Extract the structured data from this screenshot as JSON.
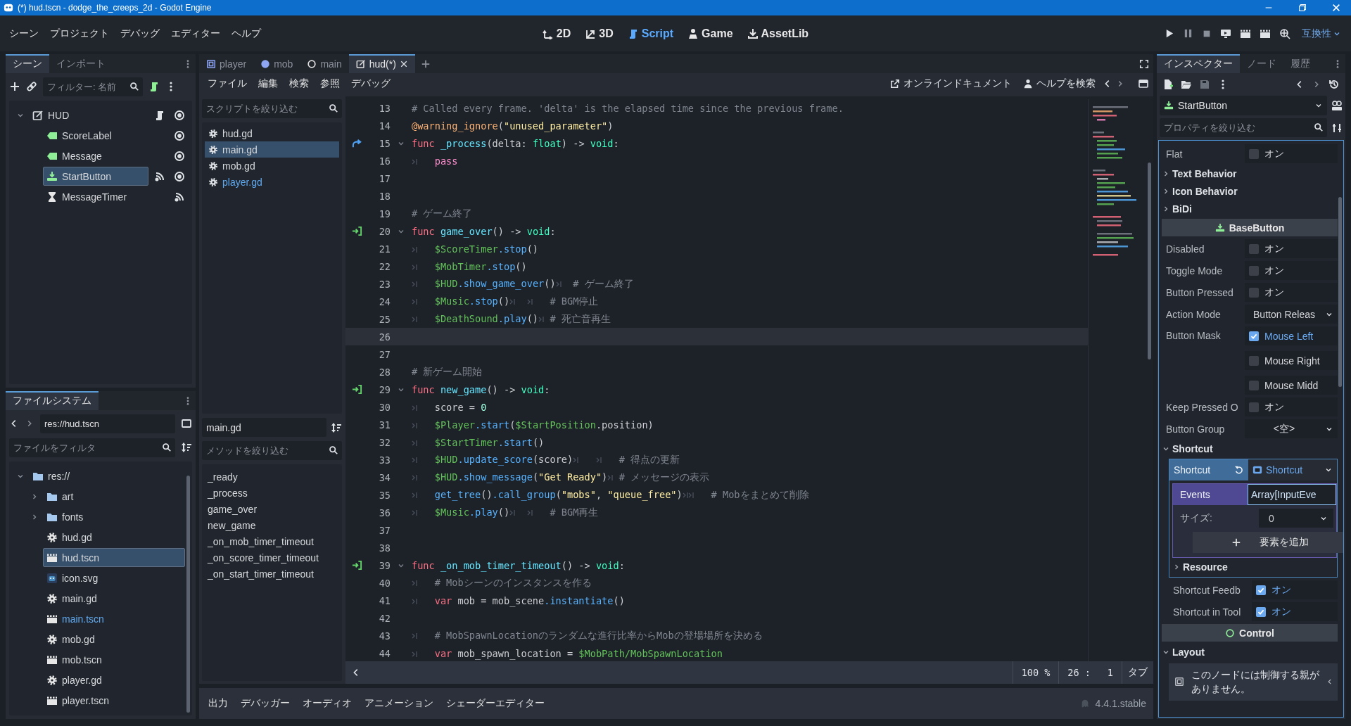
{
  "window": {
    "title": "(*) hud.tscn - dodge_the_creeps_2d - Godot Engine"
  },
  "menu": [
    "シーン",
    "プロジェクト",
    "デバッグ",
    "エディター",
    "ヘルプ"
  ],
  "workspaces": [
    {
      "label": "2D",
      "kind": "canvas",
      "selected": false
    },
    {
      "label": "3D",
      "kind": "spatial",
      "selected": false
    },
    {
      "label": "Script",
      "kind": "script",
      "selected": true
    },
    {
      "label": "Game",
      "kind": "game",
      "selected": false
    },
    {
      "label": "AssetLib",
      "kind": "assetlib",
      "selected": false
    }
  ],
  "renderer": "互換性",
  "scene_dock": {
    "tabs": [
      {
        "label": "シーン",
        "selected": true
      },
      {
        "label": "インポート",
        "selected": false
      }
    ],
    "filter": {
      "placeholder": "フィルター: 名前"
    },
    "tree": [
      {
        "name": "HUD",
        "kind": "control",
        "expanded": true,
        "selected": false,
        "script": true,
        "signals": false,
        "visible": true,
        "children": [
          {
            "name": "ScoreLabel",
            "kind": "label",
            "selected": false,
            "script": false,
            "signals": false,
            "visible": true
          },
          {
            "name": "Message",
            "kind": "label",
            "selected": false,
            "script": false,
            "signals": false,
            "visible": true
          },
          {
            "name": "StartButton",
            "kind": "button",
            "selected": true,
            "script": false,
            "signals": true,
            "visible": true
          },
          {
            "name": "MessageTimer",
            "kind": "timer",
            "selected": false,
            "script": false,
            "signals": true
          }
        ]
      }
    ]
  },
  "filesystem": {
    "tab": "ファイルシステム",
    "path": "res://hud.tscn",
    "filter": {
      "placeholder": "ファイルをフィルタ"
    },
    "tree": [
      {
        "name": "res://",
        "kind": "folder",
        "expanded": true,
        "selected": false,
        "highlighted": false,
        "children": [
          {
            "name": "art",
            "kind": "folder",
            "expanded": false,
            "selected": false,
            "highlighted": false
          },
          {
            "name": "fonts",
            "kind": "folder",
            "expanded": false,
            "selected": false,
            "highlighted": false
          },
          {
            "name": "hud.gd",
            "kind": "script",
            "selected": false,
            "highlighted": false
          },
          {
            "name": "hud.tscn",
            "kind": "scene",
            "selected": true,
            "highlighted": false
          },
          {
            "name": "icon.svg",
            "kind": "image",
            "selected": false,
            "highlighted": false
          },
          {
            "name": "main.gd",
            "kind": "script",
            "selected": false,
            "highlighted": false
          },
          {
            "name": "main.tscn",
            "kind": "scene",
            "selected": false,
            "highlighted": true
          },
          {
            "name": "mob.gd",
            "kind": "script",
            "selected": false,
            "highlighted": false
          },
          {
            "name": "mob.tscn",
            "kind": "scene",
            "selected": false,
            "highlighted": false
          },
          {
            "name": "player.gd",
            "kind": "script",
            "selected": false,
            "highlighted": false
          },
          {
            "name": "player.tscn",
            "kind": "scene",
            "selected": false,
            "highlighted": false
          }
        ]
      }
    ]
  },
  "editor_tabs": [
    {
      "label": "player",
      "kind": "node2d",
      "selected": false
    },
    {
      "label": "mob",
      "kind": "rigid",
      "selected": false
    },
    {
      "label": "main",
      "kind": "node",
      "selected": false
    },
    {
      "label": "hud(*)",
      "kind": "control",
      "selected": true
    }
  ],
  "script_menu": [
    "ファイル",
    "編集",
    "検索",
    "参照",
    "デバッグ"
  ],
  "script_links": [
    "オンラインドキュメント",
    "ヘルプを検索"
  ],
  "script_list": {
    "filter": {
      "placeholder": "スクリプトを絞り込む"
    },
    "items": [
      {
        "name": "hud.gd",
        "selected": false,
        "highlighted": false
      },
      {
        "name": "main.gd",
        "selected": true,
        "highlighted": false
      },
      {
        "name": "mob.gd",
        "selected": false,
        "highlighted": false
      },
      {
        "name": "player.gd",
        "selected": false,
        "highlighted": true
      }
    ]
  },
  "current_script": "main.gd",
  "methods": {
    "filter": {
      "placeholder": "メソッドを絞り込む"
    },
    "items": [
      "_ready",
      "_process",
      "game_over",
      "new_game",
      "_on_mob_timer_timeout",
      "_on_score_timer_timeout",
      "_on_start_timer_timeout"
    ]
  },
  "code": [
    {
      "number": "13",
      "tokens": [
        {
          "kind": "comment",
          "text": "# Called every frame. 'delta' is the elapsed time since the previous frame."
        }
      ]
    },
    {
      "number": "14",
      "tokens": [
        {
          "kind": "annotation",
          "text": "@warning_ignore"
        },
        {
          "kind": "plain",
          "text": "("
        },
        {
          "kind": "string",
          "text": "\"unused_parameter\""
        },
        {
          "kind": "plain",
          "text": ")"
        }
      ]
    },
    {
      "number": "15",
      "marker": {
        "kind": "override"
      },
      "foldable": true,
      "tokens": [
        {
          "kind": "keyword",
          "text": "func"
        },
        {
          "kind": "function",
          "text": " _process"
        },
        {
          "kind": "plain",
          "text": "(delta: "
        },
        {
          "kind": "type",
          "text": "float"
        },
        {
          "kind": "plain",
          "text": ") -> "
        },
        {
          "kind": "type",
          "text": "void"
        },
        {
          "kind": "plain",
          "text": ":"
        }
      ]
    },
    {
      "number": "16",
      "tokens": [
        {
          "kind": "tab"
        },
        {
          "kind": "control",
          "text": "pass"
        }
      ]
    },
    {
      "number": "17"
    },
    {
      "number": "18"
    },
    {
      "number": "19",
      "tokens": [
        {
          "kind": "comment",
          "text": "# ゲーム終了"
        }
      ]
    },
    {
      "number": "20",
      "marker": {
        "kind": "connected"
      },
      "foldable": true,
      "tokens": [
        {
          "kind": "keyword",
          "text": "func"
        },
        {
          "kind": "function",
          "text": " game_over"
        },
        {
          "kind": "plain",
          "text": "() -> "
        },
        {
          "kind": "type",
          "text": "void"
        },
        {
          "kind": "plain",
          "text": ":"
        }
      ]
    },
    {
      "number": "21",
      "tokens": [
        {
          "kind": "tab"
        },
        {
          "kind": "node",
          "text": "$ScoreTimer"
        },
        {
          "kind": "method",
          "text": ".stop"
        },
        {
          "kind": "plain",
          "text": "()"
        }
      ]
    },
    {
      "number": "22",
      "tokens": [
        {
          "kind": "tab"
        },
        {
          "kind": "node",
          "text": "$MobTimer"
        },
        {
          "kind": "method",
          "text": ".stop"
        },
        {
          "kind": "plain",
          "text": "()"
        }
      ]
    },
    {
      "number": "23",
      "tokens": [
        {
          "kind": "tab"
        },
        {
          "kind": "node",
          "text": "$HUD"
        },
        {
          "kind": "method",
          "text": ".show_game_over"
        },
        {
          "kind": "plain",
          "text": "()"
        },
        {
          "kind": "tab"
        },
        {
          "kind": "comment",
          "text": "# ゲーム終了"
        }
      ]
    },
    {
      "number": "24",
      "tokens": [
        {
          "kind": "tab"
        },
        {
          "kind": "node",
          "text": "$Music"
        },
        {
          "kind": "method",
          "text": ".stop"
        },
        {
          "kind": "plain",
          "text": "()"
        },
        {
          "kind": "tab"
        },
        {
          "kind": "tab"
        },
        {
          "kind": "comment",
          "text": "# BGM停止"
        }
      ]
    },
    {
      "number": "25",
      "tokens": [
        {
          "kind": "tab"
        },
        {
          "kind": "node",
          "text": "$DeathSound"
        },
        {
          "kind": "method",
          "text": ".play"
        },
        {
          "kind": "plain",
          "text": "()"
        },
        {
          "kind": "tab"
        },
        {
          "kind": "comment",
          "text": "# 死亡音再生"
        }
      ]
    },
    {
      "number": "26",
      "current": true
    },
    {
      "number": "27"
    },
    {
      "number": "28",
      "tokens": [
        {
          "kind": "comment",
          "text": "# 新ゲーム開始"
        }
      ]
    },
    {
      "number": "29",
      "marker": {
        "kind": "connected"
      },
      "foldable": true,
      "tokens": [
        {
          "kind": "keyword",
          "text": "func"
        },
        {
          "kind": "function",
          "text": " new_game"
        },
        {
          "kind": "plain",
          "text": "() -> "
        },
        {
          "kind": "type",
          "text": "void"
        },
        {
          "kind": "plain",
          "text": ":"
        }
      ]
    },
    {
      "number": "30",
      "tokens": [
        {
          "kind": "tab"
        },
        {
          "kind": "plain",
          "text": "score = "
        },
        {
          "kind": "number",
          "text": "0"
        }
      ]
    },
    {
      "number": "31",
      "tokens": [
        {
          "kind": "tab"
        },
        {
          "kind": "node",
          "text": "$Player"
        },
        {
          "kind": "method",
          "text": ".start"
        },
        {
          "kind": "plain",
          "text": "("
        },
        {
          "kind": "node",
          "text": "$StartPosition"
        },
        {
          "kind": "plain",
          "text": ".position)"
        }
      ]
    },
    {
      "number": "32",
      "tokens": [
        {
          "kind": "tab"
        },
        {
          "kind": "node",
          "text": "$StartTimer"
        },
        {
          "kind": "method",
          "text": ".start"
        },
        {
          "kind": "plain",
          "text": "()"
        }
      ]
    },
    {
      "number": "33",
      "tokens": [
        {
          "kind": "tab"
        },
        {
          "kind": "node",
          "text": "$HUD"
        },
        {
          "kind": "method",
          "text": ".update_score"
        },
        {
          "kind": "plain",
          "text": "(score)"
        },
        {
          "kind": "tab"
        },
        {
          "kind": "tab"
        },
        {
          "kind": "comment",
          "text": "# 得点の更新"
        }
      ]
    },
    {
      "number": "34",
      "tokens": [
        {
          "kind": "tab"
        },
        {
          "kind": "node",
          "text": "$HUD"
        },
        {
          "kind": "method",
          "text": ".show_message"
        },
        {
          "kind": "plain",
          "text": "("
        },
        {
          "kind": "string",
          "text": "\"Get Ready\""
        },
        {
          "kind": "plain",
          "text": ")"
        },
        {
          "kind": "tab"
        },
        {
          "kind": "comment",
          "text": "# メッセージの表示"
        }
      ]
    },
    {
      "number": "35",
      "tokens": [
        {
          "kind": "tab"
        },
        {
          "kind": "method",
          "text": "get_tree"
        },
        {
          "kind": "plain",
          "text": "()"
        },
        {
          "kind": "method",
          "text": ".call_group"
        },
        {
          "kind": "plain",
          "text": "("
        },
        {
          "kind": "string",
          "text": "\"mobs\""
        },
        {
          "kind": "plain",
          "text": ", "
        },
        {
          "kind": "string",
          "text": "\"queue_free\""
        },
        {
          "kind": "plain",
          "text": ")"
        },
        {
          "kind": "tab"
        },
        {
          "kind": "tab"
        },
        {
          "kind": "comment",
          "text": "# Mobをまとめて削除"
        }
      ]
    },
    {
      "number": "36",
      "tokens": [
        {
          "kind": "tab"
        },
        {
          "kind": "node",
          "text": "$Music"
        },
        {
          "kind": "method",
          "text": ".play"
        },
        {
          "kind": "plain",
          "text": "()"
        },
        {
          "kind": "tab"
        },
        {
          "kind": "tab"
        },
        {
          "kind": "comment",
          "text": "# BGM再生"
        }
      ]
    },
    {
      "number": "37"
    },
    {
      "number": "38"
    },
    {
      "number": "39",
      "marker": {
        "kind": "connected"
      },
      "foldable": true,
      "tokens": [
        {
          "kind": "keyword",
          "text": "func"
        },
        {
          "kind": "function",
          "text": " _on_mob_timer_timeout"
        },
        {
          "kind": "plain",
          "text": "() -> "
        },
        {
          "kind": "type",
          "text": "void"
        },
        {
          "kind": "plain",
          "text": ":"
        }
      ]
    },
    {
      "number": "40",
      "tokens": [
        {
          "kind": "tab"
        },
        {
          "kind": "comment",
          "text": "# Mobシーンのインスタンスを作る"
        }
      ]
    },
    {
      "number": "41",
      "tokens": [
        {
          "kind": "tab"
        },
        {
          "kind": "keyword",
          "text": "var"
        },
        {
          "kind": "plain",
          "text": " mob = mob_scene"
        },
        {
          "kind": "method",
          "text": ".instantiate"
        },
        {
          "kind": "plain",
          "text": "()"
        }
      ]
    },
    {
      "number": "42"
    },
    {
      "number": "43",
      "tokens": [
        {
          "kind": "tab"
        },
        {
          "kind": "comment",
          "text": "# MobSpawnLocationのランダムな進行比率からMobの登場場所を決める"
        }
      ]
    },
    {
      "number": "44",
      "tokens": [
        {
          "kind": "tab"
        },
        {
          "kind": "keyword",
          "text": "var"
        },
        {
          "kind": "plain",
          "text": " mob_spawn_location = "
        },
        {
          "kind": "node",
          "text": "$MobPath/MobSpawnLocation"
        }
      ]
    }
  ],
  "code_status": {
    "zoom": "100 %",
    "line": "26 :",
    "column": "1",
    "indent": "タブ"
  },
  "bottom_tabs": [
    "出力",
    "デバッガー",
    "オーディオ",
    "アニメーション",
    "シェーダーエディター"
  ],
  "version": "4.4.1.stable",
  "inspector": {
    "tabs": [
      {
        "label": "インスペクター",
        "selected": true
      },
      {
        "label": "ノード",
        "selected": false
      },
      {
        "label": "履歴",
        "selected": false
      }
    ],
    "object": "StartButton",
    "filter": {
      "placeholder": "プロパティを絞り込む"
    },
    "properties": [
      {
        "kind": "check",
        "label": "Flat",
        "value": "オン",
        "checked": false
      },
      {
        "kind": "group",
        "label": "Text Behavior",
        "expanded": false
      },
      {
        "kind": "group",
        "label": "Icon Behavior",
        "expanded": false
      },
      {
        "kind": "group",
        "label": "BiDi",
        "expanded": false
      },
      {
        "kind": "category",
        "label": "BaseButton",
        "node": {
          "kind": "button"
        }
      },
      {
        "kind": "check",
        "label": "Disabled",
        "value": "オン",
        "checked": false
      },
      {
        "kind": "check",
        "label": "Toggle Mode",
        "value": "オン",
        "checked": false
      },
      {
        "kind": "check",
        "label": "Button Pressed",
        "value": "オン",
        "checked": false
      },
      {
        "kind": "enum",
        "label": "Action Mode",
        "value": "Button Releas"
      },
      {
        "kind": "flags",
        "label": "Button Mask",
        "flags": [
          {
            "label": "Mouse Left",
            "checked": true
          },
          {
            "label": "Mouse Right",
            "checked": false
          },
          {
            "label": "Mouse Midd",
            "checked": false
          }
        ]
      },
      {
        "kind": "check",
        "label": "Keep Pressed O",
        "value": "オン",
        "checked": false
      },
      {
        "kind": "enum",
        "label": "Button Group",
        "value": "<空>"
      },
      {
        "kind": "group",
        "label": "Shortcut",
        "expanded": true,
        "children": [
          {
            "kind": "resource",
            "label": "Shortcut",
            "value": "Shortcut",
            "children": [
              {
                "kind": "array",
                "label": "Events",
                "value": "Array[InputEve",
                "children": [
                  {
                    "kind": "size",
                    "label": "サイズ:",
                    "value": "0"
                  },
                  {
                    "kind": "add",
                    "label": "要素を追加"
                  }
                ]
              },
              {
                "kind": "group",
                "label": "Resource",
                "expanded": false
              }
            ]
          },
          {
            "kind": "check",
            "label": "Shortcut Feedb",
            "value": "オン",
            "checked": true
          },
          {
            "kind": "check",
            "label": "Shortcut in Tool",
            "value": "オン",
            "checked": true
          }
        ]
      },
      {
        "kind": "category",
        "label": "Control",
        "node": {
          "kind": "control"
        }
      },
      {
        "kind": "group",
        "label": "Layout",
        "expanded": true,
        "children": [
          {
            "kind": "warning",
            "text": "このノードには制御する親がありません。"
          }
        ]
      }
    ]
  }
}
